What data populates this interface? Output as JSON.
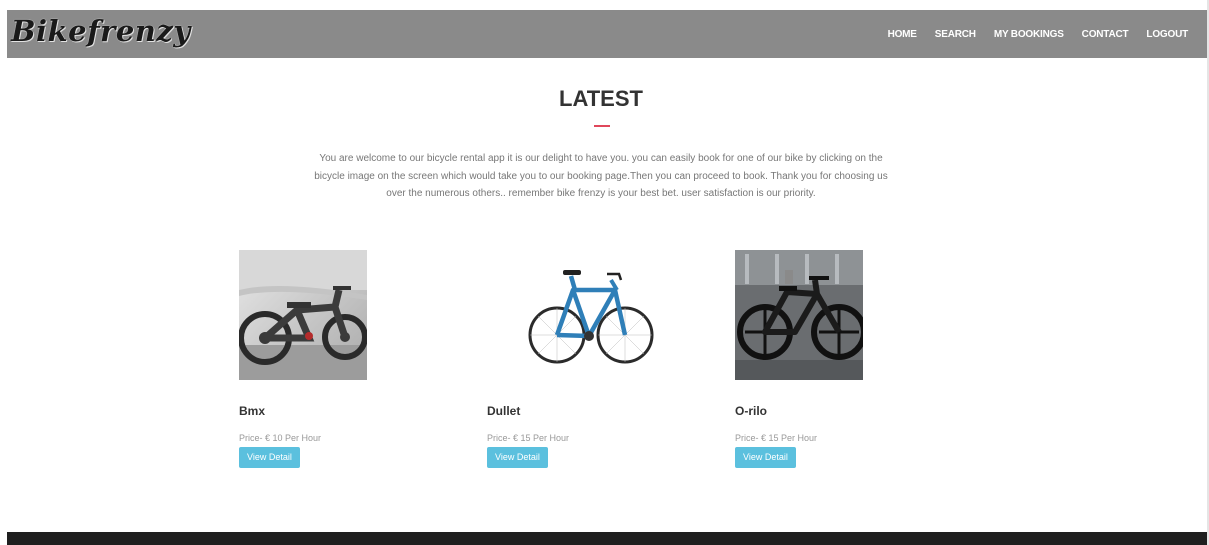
{
  "navbar": {
    "brand": "Bikefrenzy",
    "links": [
      "HOME",
      "SEARCH",
      "MY BOOKINGS",
      "CONTACT",
      "LOGOUT"
    ]
  },
  "section": {
    "title": "LATEST",
    "intro": "You are welcome to our bicycle rental app it is our delight to have you. you can easily book for one of our bike by clicking on the bicycle image on the screen which would take you to our booking page.Then you can proceed to book. Thank you for choosing us over the numerous others.. remember bike frenzy is your best bet. user satisfaction is our priority."
  },
  "products": [
    {
      "name": "Bmx",
      "price": "Price- € 10 Per Hour",
      "button": "View Detail"
    },
    {
      "name": "Dullet",
      "price": "Price- € 15 Per Hour",
      "button": "View Detail"
    },
    {
      "name": "O-rilo",
      "price": "Price- € 15 Per Hour",
      "button": "View Detail"
    }
  ],
  "colors": {
    "navbar": "#8a8a8a",
    "accent_rule": "#e0475b",
    "button": "#5bc0de",
    "footer": "#1f1f1f"
  }
}
